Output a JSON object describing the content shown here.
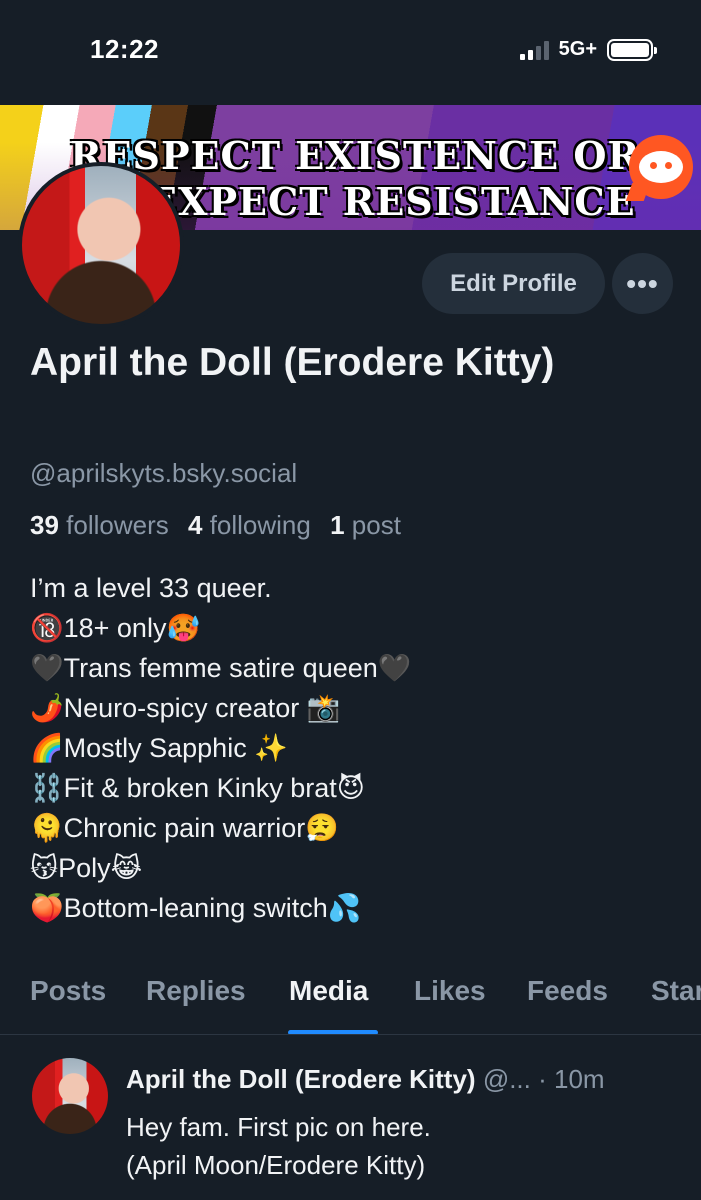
{
  "status_bar": {
    "time": "12:22",
    "network": "5G+",
    "signal_bars": 4,
    "signal_active": 2,
    "battery_level": 1.0
  },
  "banner": {
    "line1": "RESPECT EXISTENCE OR",
    "line2": "EXPECT RESISTANCE",
    "icon": "reddit-snoo-icon"
  },
  "profile": {
    "display_name": "April the Doll (Erodere Kitty)",
    "handle": "@aprilskyts.bsky.social",
    "followers_count": "39",
    "followers_label": "followers",
    "following_count": "4",
    "following_label": "following",
    "posts_count": "1",
    "posts_label": "post"
  },
  "actions": {
    "edit_profile": "Edit Profile",
    "more": "•••"
  },
  "bio": [
    "I’m a level 33 queer.",
    "🔞18+ only🥵",
    "🖤Trans femme satire queen🖤",
    "🌶️Neuro-spicy creator 📸",
    "🌈Mostly Sapphic ✨",
    "⛓️Fit & broken Kinky brat😈",
    "🫠Chronic pain warrior😮‍💨",
    "😽Poly😹",
    "🍑Bottom-leaning switch💦"
  ],
  "tabs": [
    {
      "label": "Posts"
    },
    {
      "label": "Replies"
    },
    {
      "label": "Media",
      "active": true
    },
    {
      "label": "Likes"
    },
    {
      "label": "Feeds"
    },
    {
      "label": "Starter Packs"
    }
  ],
  "post": {
    "author": "April the Doll (Erodere Kitty)",
    "handle_truncated": "@...",
    "time": "· 10m",
    "text_line1": "Hey fam. First pic on here.",
    "text_line2": "(April Moon/Erodere Kitty)"
  },
  "colors": {
    "background": "#161e27",
    "accent": "#208bfe",
    "muted_text": "#8a97a6",
    "button_bg": "#242f3b"
  }
}
